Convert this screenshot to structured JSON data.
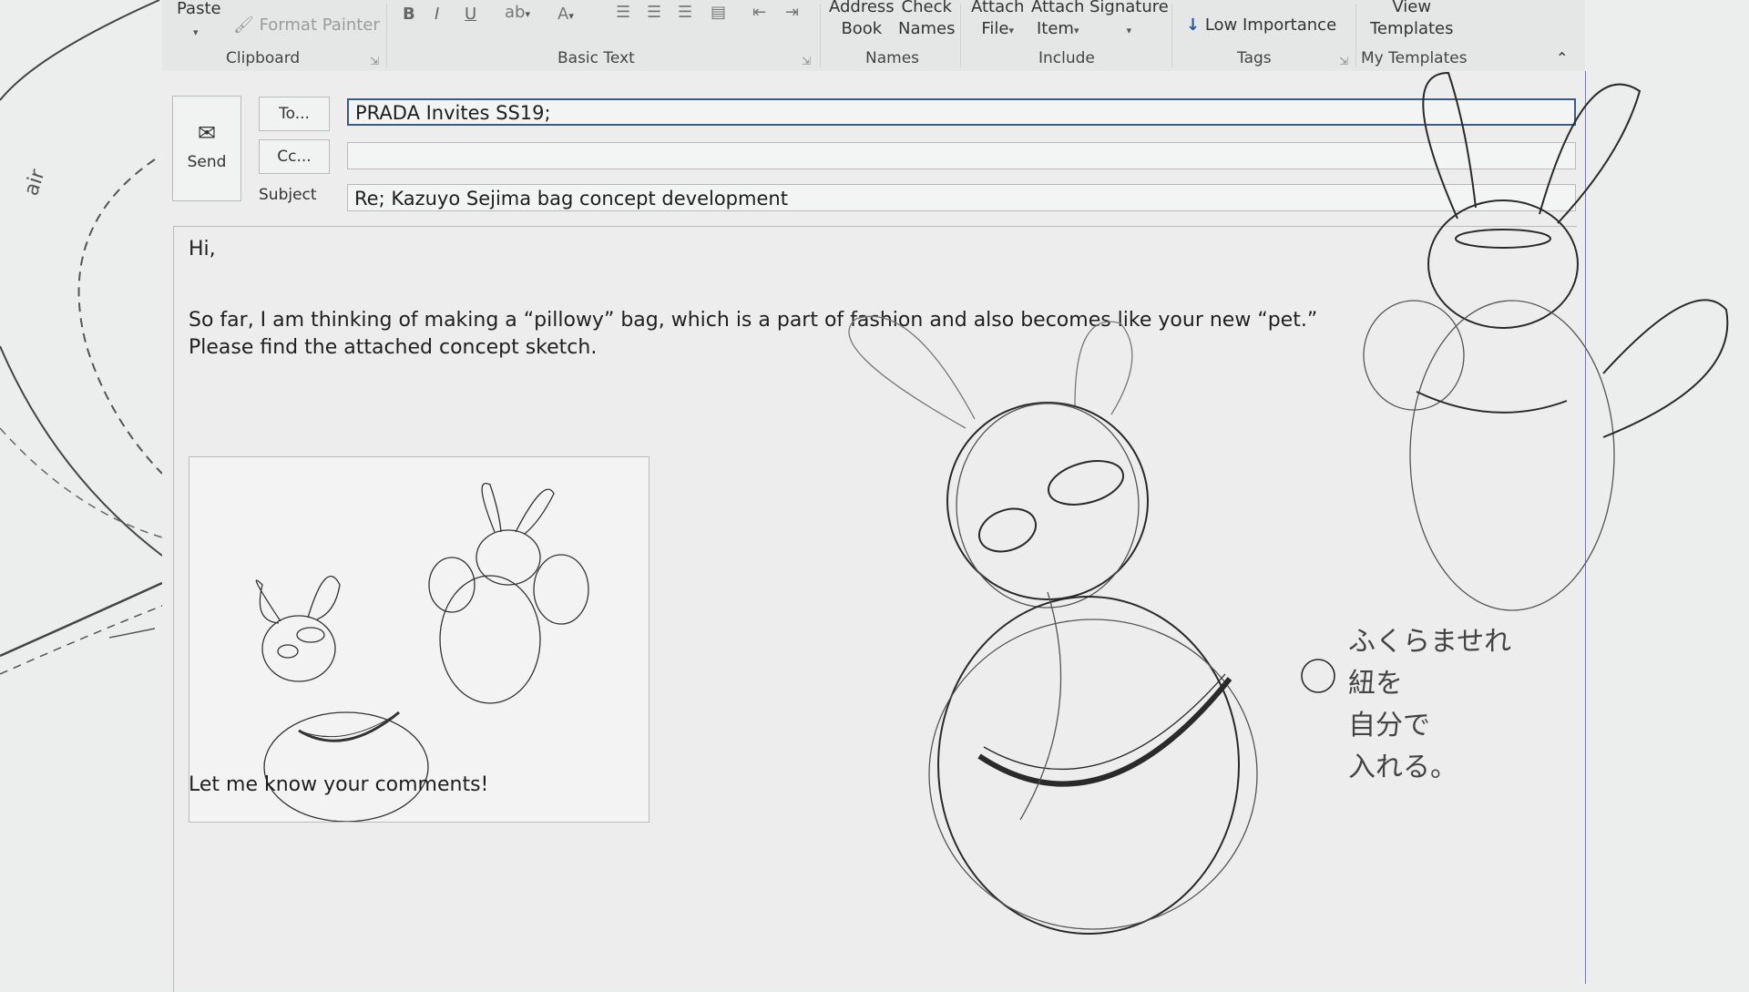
{
  "ribbon": {
    "paste": "Paste",
    "format_painter": "Format Painter",
    "groups": {
      "clipboard": "Clipboard",
      "basic_text": "Basic Text",
      "names": "Names",
      "include": "Include",
      "tags": "Tags",
      "my_templates": "My Templates"
    },
    "buttons": {
      "bold": "B",
      "italic": "I",
      "underline": "U",
      "address_book_1": "Address",
      "address_book_2": "Book",
      "check_names_1": "Check",
      "check_names_2": "Names",
      "attach_file_1": "Attach",
      "attach_file_2": "File",
      "attach_item_1": "Attach",
      "attach_item_2": "Item",
      "signature": "Signature",
      "low_importance": "Low Importance",
      "view_templates_1": "View",
      "view_templates_2": "Templates"
    }
  },
  "compose": {
    "send": "Send",
    "to_button": "To...",
    "cc_button": "Cc...",
    "subject_label": "Subject",
    "to_value": "PRADA Invites SS19;",
    "cc_value": "",
    "subject_value": "Re; Kazuyo Sejima bag concept development"
  },
  "body": {
    "greeting": "Hi,",
    "line1": "So far, I am thinking of making a “pillowy” bag, which is a part of fashion and also becomes like your new “pet.”",
    "line2": "Please find the attached concept sketch.",
    "closing": "Let me know your comments!"
  },
  "sketch": {
    "bg_left_label": "air",
    "note_lines": [
      "ふくらませれ",
      "紐を",
      "自分で",
      "入れる。"
    ],
    "circle_mark": "⊕"
  },
  "colors": {
    "background": "#eceeed",
    "to_field_border": "#3c5a82",
    "window_edge": "#7a7aa8",
    "low_importance_arrow": "#2b5797"
  }
}
